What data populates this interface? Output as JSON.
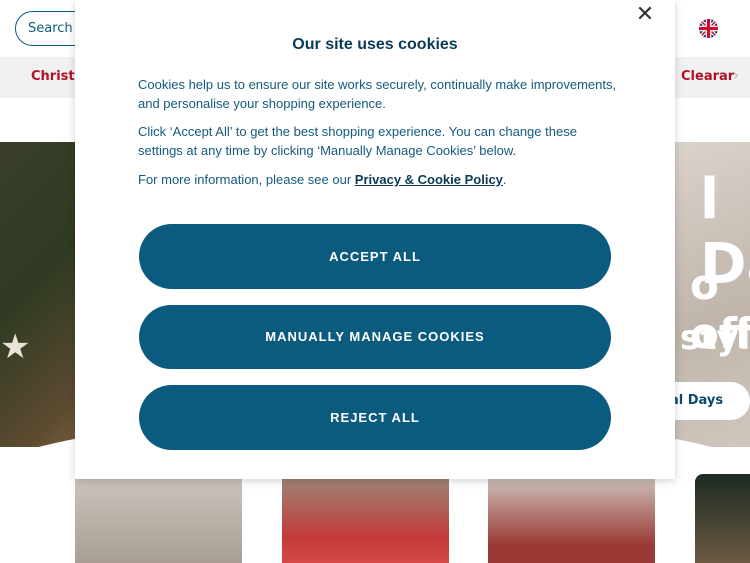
{
  "header": {
    "search_placeholder": "Search",
    "language_flag_icon": "uk-flag-icon"
  },
  "nav": {
    "left_item": "Christm",
    "right_item": "Clearar",
    "chevron_icon": "chevron-right-icon"
  },
  "hero": {
    "headline_fragment": "l Da",
    "offer_fragment": "o off",
    "style_fragment": "style",
    "cta_fragment": "al Days"
  },
  "cookie_modal": {
    "close_icon": "close-icon",
    "title": "Our site uses cookies",
    "paragraph_1": "Cookies help us to ensure our site works securely, continually make improvements, and personalise your shopping experience.",
    "paragraph_2": "Click ‘Accept All’ to get the best shopping experience. You can change these settings at any time by clicking ‘Manually Manage Cookies’ below.",
    "paragraph_3_prefix": "For more information, please see our ",
    "policy_link": "Privacy & Cookie Policy",
    "paragraph_3_suffix": ".",
    "accept_all_label": "ACCEPT ALL",
    "manage_label": "MANUALLY MANAGE COOKIES",
    "reject_all_label": "REJECT ALL",
    "button_color": "#0b5b7e"
  }
}
